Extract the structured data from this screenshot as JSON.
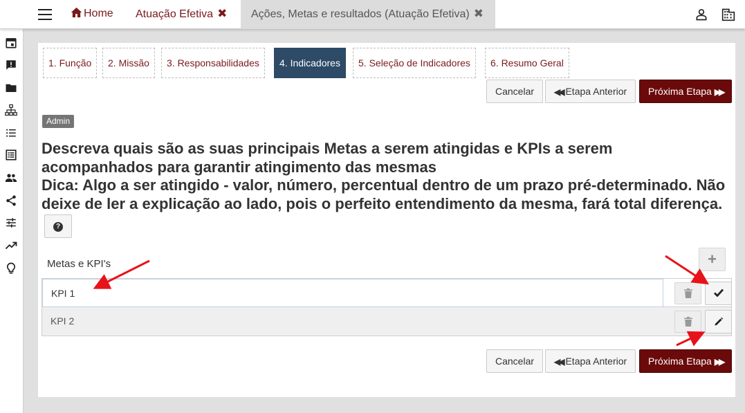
{
  "topbar": {
    "home_label": "Home",
    "tab1_label": "Atuação Efetiva",
    "tab2_label": "Ações, Metas e resultados (Atuação Efetiva)",
    "close_glyph": "✖"
  },
  "steps": [
    {
      "label": "1. Função"
    },
    {
      "label": "2. Missão"
    },
    {
      "label": "3. Responsabilidades"
    },
    {
      "label": "4. Indicadores"
    },
    {
      "label": "5. Seleção de Indicadores"
    },
    {
      "label": "6. Resumo Geral"
    }
  ],
  "buttons": {
    "cancel": "Cancelar",
    "prev": "Etapa Anterior",
    "next": "Próxima Etapa"
  },
  "badge": "Admin",
  "question": {
    "line1": "Descreva quais são as suas principais Metas a serem atingidas e KPIs a serem acompanhados para garantir atingimento das mesmas",
    "line2": "Dica: Algo a ser atingido - valor, número, percentual dentro de um prazo pré-determinado. Não deixe de ler a explicação ao lado, pois o perfeito entendimento da mesma, fará total diferença."
  },
  "list": {
    "label": "Metas e KPI's",
    "items": [
      {
        "value": "KPI 1",
        "editing": true
      },
      {
        "value": "KPI 2",
        "editing": false
      }
    ]
  },
  "colors": {
    "brand": "#6b0a0a",
    "active_step": "#2d4a66",
    "arrow": "#e8121a"
  },
  "icons": {
    "sidebar": [
      "calendar-icon",
      "feedback-icon",
      "folder-icon",
      "org-chart-icon",
      "list-icon",
      "document-list-icon",
      "people-icon",
      "share-icon",
      "tune-icon",
      "trending-up-icon",
      "lightbulb-icon"
    ],
    "top": [
      "user-icon",
      "building-icon"
    ]
  }
}
